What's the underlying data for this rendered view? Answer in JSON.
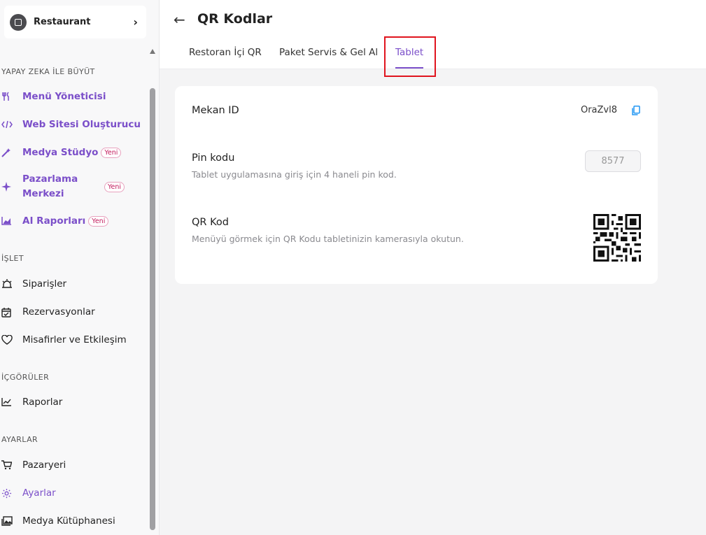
{
  "store": {
    "name": "Restaurant"
  },
  "sidebar": {
    "sections": [
      {
        "title": "YAPAY ZEKA İLE BÜYÜT"
      },
      {
        "title": "İŞLET"
      },
      {
        "title": "İÇGÖRÜLER"
      },
      {
        "title": "AYARLAR"
      }
    ],
    "items": [
      {
        "label": "Menü Yöneticisi",
        "icon": "cutlery-icon"
      },
      {
        "label": "Web Sitesi Oluşturucu",
        "icon": "code-icon"
      },
      {
        "label": "Medya Stüdyo",
        "badge": "Yeni",
        "icon": "magic-wand-icon"
      },
      {
        "label": "Pazarlama Merkezi",
        "badge": "Yeni",
        "icon": "sparkle-icon"
      },
      {
        "label": "AI Raporları",
        "badge": "Yeni",
        "icon": "chart-icon"
      },
      {
        "label": "Siparişler",
        "icon": "bell-icon"
      },
      {
        "label": "Rezervasyonlar",
        "icon": "calendar-check-icon"
      },
      {
        "label": "Misafirler ve Etkileşim",
        "icon": "heart-icon"
      },
      {
        "label": "Raporlar",
        "icon": "line-chart-icon"
      },
      {
        "label": "Pazaryeri",
        "icon": "cart-icon"
      },
      {
        "label": "Ayarlar",
        "icon": "gear-icon",
        "active": true
      },
      {
        "label": "Medya Kütüphanesi",
        "icon": "image-library-icon"
      }
    ]
  },
  "header": {
    "title": "QR Kodlar",
    "tabs": [
      {
        "label": "Restoran İçi QR"
      },
      {
        "label": "Paket Servis & Gel Al"
      },
      {
        "label": "Tablet",
        "active": true
      }
    ]
  },
  "card": {
    "venue": {
      "title": "Mekan ID",
      "value": "OraZvl8"
    },
    "pin": {
      "title": "Pin kodu",
      "description": "Tablet uygulamasına giriş için 4 haneli pin kod.",
      "value": "8577"
    },
    "qr": {
      "title": "QR Kod",
      "description": "Menüyü görmek için QR Kodu tabletinizin kamerasıyla okutun."
    }
  },
  "colors": {
    "accent": "#7b4fc9",
    "badge": "#c2185b",
    "highlight": "#e0141e"
  }
}
